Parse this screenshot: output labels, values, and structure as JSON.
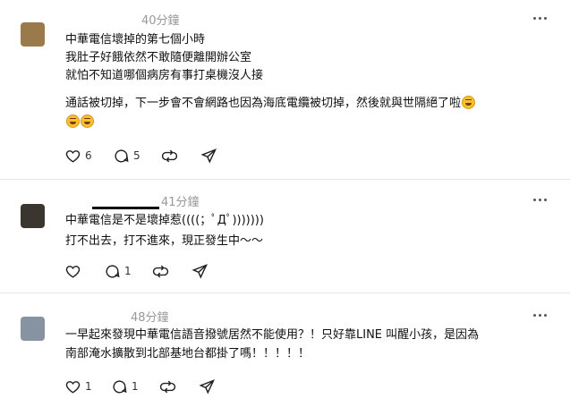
{
  "colors": {
    "text": "#101010",
    "muted": "#999999",
    "divider": "#e6e6e6"
  },
  "posts": [
    {
      "avatar_color": "#9a7a4a",
      "timestamp": "40分鐘",
      "lines": [
        "中華電信壞掉的第七個小時",
        "我肚子好餓依然不敢隨便離開辦公室",
        "就怕不知道哪個病房有事打桌機沒人接"
      ],
      "paragraph": "通話被切掉，下一步會不會網路也因為海底電纜被切掉，然後就與世隔絕了啦",
      "emoji_icons": [
        "rolling-laughing-icon",
        "rolling-laughing-icon",
        "rolling-laughing-icon"
      ],
      "likes": "6",
      "replies": "5",
      "reposts": "",
      "shares": ""
    },
    {
      "avatar_color": "#3b352f",
      "timestamp": "41分鐘",
      "lines": [
        "中華電信是不是壞掉惹((((；ﾟДﾟ)))))))",
        "打不出去，打不進來，現正發生中～～"
      ],
      "likes": "",
      "replies": "1",
      "reposts": "",
      "shares": ""
    },
    {
      "avatar_color": "#8693a0",
      "timestamp": "48分鐘",
      "lines": [
        "一早起來發現中華電信語音撥號居然不能使用？！只好靠LINE 叫醒小孩，是因為",
        "南部淹水擴散到北部基地台都掛了嗎！！！！！"
      ],
      "likes": "1",
      "replies": "1",
      "reposts": "",
      "shares": ""
    }
  ]
}
